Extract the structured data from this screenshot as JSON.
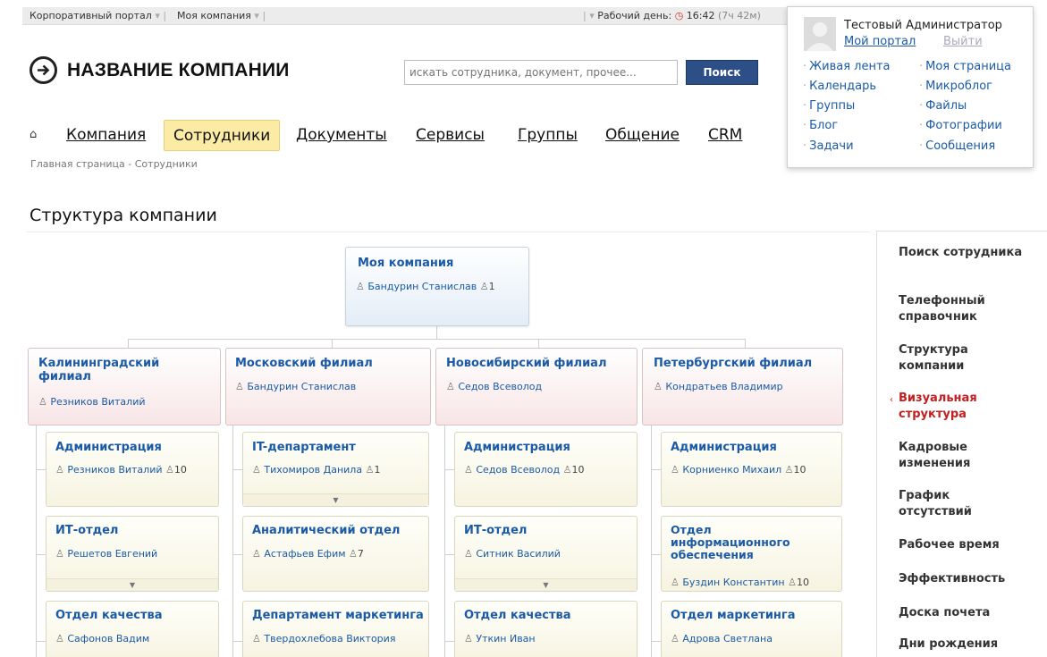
{
  "topbar": {
    "portal": "Корпоративный портал",
    "company": "Моя компания",
    "workday_label": "Рабочий день:",
    "time": "16:42",
    "duration": "(7ч 42м)"
  },
  "header": {
    "logo_text": "НАЗВАНИЕ КОМПАНИИ",
    "search_placeholder": "искать сотрудника, документ, прочее...",
    "search_button": "Поиск"
  },
  "nav": {
    "items": [
      "Компания",
      "Сотрудники",
      "Документы",
      "Сервисы",
      "Группы",
      "Общение",
      "CRM"
    ],
    "active": "Сотрудники"
  },
  "breadcrumb": {
    "home": "Главная страница",
    "separator": "-",
    "current": "Сотрудники"
  },
  "page_title": "Структура компании",
  "user_popup": {
    "name": "Тестовый Администратор",
    "my_portal": "Мой портал",
    "logout": "Выйти",
    "links_left": [
      "Живая лента",
      "Календарь",
      "Группы",
      "Блог",
      "Задачи"
    ],
    "links_right": [
      "Моя страница",
      "Микроблог",
      "Файлы",
      "Фотографии",
      "Сообщения"
    ]
  },
  "org": {
    "root": {
      "title": "Моя компания",
      "head": "Бандурин Станислав",
      "count": "1"
    },
    "branches": [
      {
        "title": "Калининградский филиал",
        "head": "Резников Виталий"
      },
      {
        "title": "Московский филиал",
        "head": "Бандурин Станислав"
      },
      {
        "title": "Новосибирский филиал",
        "head": "Седов Всеволод"
      },
      {
        "title": "Петербургский филиал",
        "head": "Кондратьев Владимир"
      }
    ],
    "departments": [
      [
        {
          "title": "Администрация",
          "head": "Резников Виталий",
          "count": "10"
        },
        {
          "title": "ИТ-отдел",
          "head": "Решетов Евгений",
          "count": ""
        },
        {
          "title": "Отдел качества",
          "head": "Сафонов Вадим",
          "count": ""
        }
      ],
      [
        {
          "title": "IT-департамент",
          "head": "Тихомиров Данила",
          "count": "1"
        },
        {
          "title": "Аналитический отдел",
          "head": "Астафьев Ефим",
          "count": "7"
        },
        {
          "title": "Департамент маркетинга",
          "head": "Твердохлебова Виктория",
          "count": ""
        }
      ],
      [
        {
          "title": "Администрация",
          "head": "Седов Всеволод",
          "count": "10"
        },
        {
          "title": "ИТ-отдел",
          "head": "Ситник Василий",
          "count": ""
        },
        {
          "title": "Отдел качества",
          "head": "Уткин Иван",
          "count": ""
        }
      ],
      [
        {
          "title": "Администрация",
          "head": "Корниенко Михаил",
          "count": "10"
        },
        {
          "title": "Отдел информационного обеспечения",
          "head": "Буздин Константин",
          "count": "10"
        },
        {
          "title": "Отдел маркетинга",
          "head": "Адрова Светлана",
          "count": ""
        }
      ]
    ]
  },
  "right_menu": {
    "items": [
      "Поиск сотрудника",
      "Телефонный справочник",
      "Структура компании",
      "Визуальная структура",
      "Кадровые изменения",
      "График отсутствий",
      "Рабочее время",
      "Эффективность",
      "Доска почета",
      "Дни рождения"
    ],
    "active": "Визуальная структура"
  },
  "colors": {
    "link": "#1a5aa6",
    "active_nav": "#fbeba5",
    "search_button": "#2d4f87",
    "active_menu": "#c12020"
  }
}
